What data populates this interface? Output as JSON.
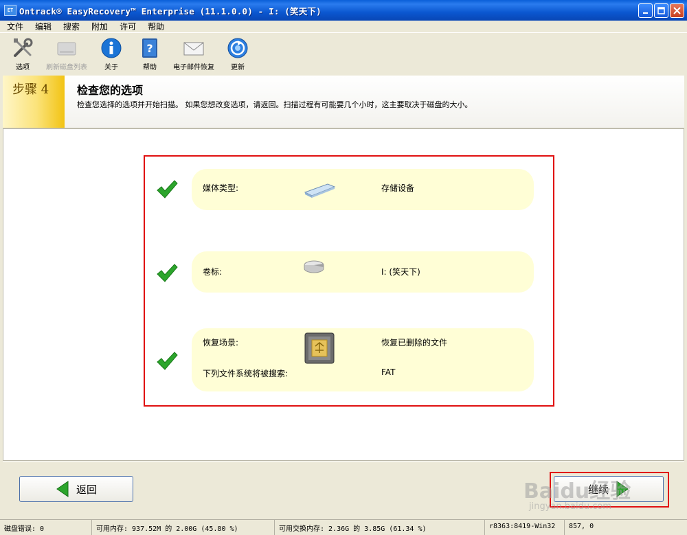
{
  "window": {
    "icon_text": "ET",
    "title": "Ontrack® EasyRecovery™ Enterprise (11.1.0.0) - I: (笑天下)"
  },
  "menu": [
    "文件",
    "编辑",
    "搜索",
    "附加",
    "许可",
    "帮助"
  ],
  "toolbar": [
    {
      "label": "选项",
      "icon": "tools-icon",
      "enabled": true
    },
    {
      "label": "刷新磁盘列表",
      "icon": "disk-refresh-icon",
      "enabled": false
    },
    {
      "label": "关于",
      "icon": "info-icon",
      "enabled": true
    },
    {
      "label": "帮助",
      "icon": "help-book-icon",
      "enabled": true
    },
    {
      "label": "电子邮件恢复",
      "icon": "envelope-icon",
      "enabled": true
    },
    {
      "label": "更新",
      "icon": "update-icon",
      "enabled": true
    }
  ],
  "header": {
    "step": "步骤 4",
    "title": "检查您的选项",
    "description": "检查您选择的选项并开始扫描。 如果您想改变选项，请返回。扫描过程有可能要几个小时，这主要取决于磁盘的大小。"
  },
  "summary": {
    "media": {
      "label": "媒体类型:",
      "value": "存储设备",
      "icon": "usb-drive-icon"
    },
    "volume": {
      "label": "卷标:",
      "value": "I: (笑天下)",
      "icon": "volume-icon"
    },
    "scenario": {
      "label": "恢复场景:",
      "value": "恢复已删除的文件",
      "icon": "recycle-bin-icon"
    },
    "filesystem": {
      "label": "下列文件系统将被搜索:",
      "value": "FAT"
    }
  },
  "footer": {
    "back_label": "返回",
    "continue_label": "继续"
  },
  "status": {
    "disk_errors": "磁盘错误: 0",
    "memory": "可用内存: 937.52M 的 2.00G (45.80 %)",
    "swap": "可用交换内存: 2.36G 的 3.85G (61.34 %)",
    "build": "r8363:8419-Win32",
    "coords": "857, 0"
  },
  "watermark": {
    "brand": "Baidu经验",
    "url": "jingyan.baidu.com"
  },
  "colors": {
    "highlight_box": "#e01010",
    "card_bg": "#fffed6",
    "check_green": "#2ca52c",
    "titlebar": "#0b57d0"
  }
}
